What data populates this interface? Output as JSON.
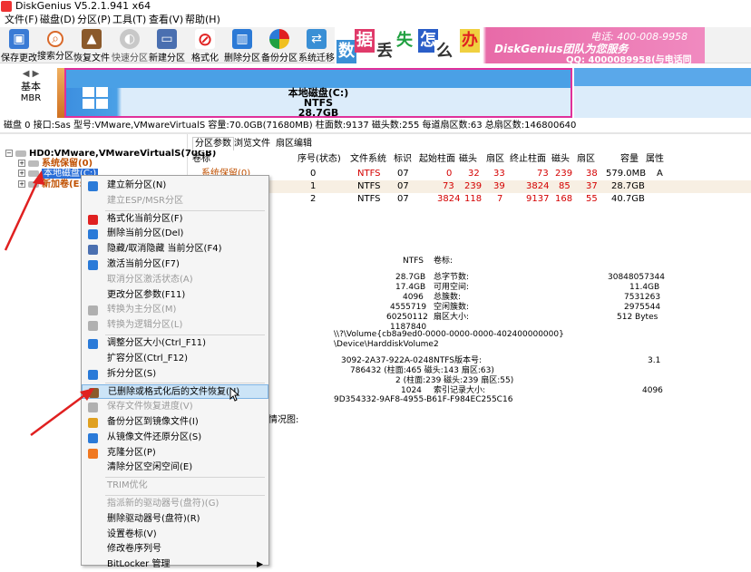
{
  "window": {
    "title": "DiskGenius V5.2.1.941 x64"
  },
  "menubar": [
    "文件(F)",
    "磁盘(D)",
    "分区(P)",
    "工具(T)",
    "查看(V)",
    "帮助(H)"
  ],
  "toolbar": [
    {
      "label": "保存更改",
      "icon": "save-icon",
      "color": "#3a7bd5"
    },
    {
      "label": "搜索分区",
      "icon": "search-icon",
      "color": "#d9692a"
    },
    {
      "label": "恢复文件",
      "icon": "recover-icon",
      "color": "#8b5a2b"
    },
    {
      "label": "快速分区",
      "icon": "quick-partition-icon",
      "color": "#9a9a9a"
    },
    {
      "label": "新建分区",
      "icon": "new-partition-icon",
      "color": "#4a6fb0"
    },
    {
      "label": "格式化",
      "icon": "format-icon",
      "color": "#e02020"
    },
    {
      "label": "删除分区",
      "icon": "delete-icon",
      "color": "#2c7ad6"
    },
    {
      "label": "备份分区",
      "icon": "backup-icon",
      "color": "#e0a020"
    },
    {
      "label": "系统迁移",
      "icon": "migrate-icon",
      "color": "#3a8fd5"
    }
  ],
  "banner": {
    "chars": [
      "数",
      "据",
      "丢",
      "失",
      "怎",
      "么",
      "办"
    ],
    "slogan": "DiskGenius团队为您服务",
    "phone": "电话: 400-008-9958",
    "qq": "QQ: 4000089958(与电话同号)"
  },
  "diskmap": {
    "disk_label": "基本",
    "disk_type": "MBR",
    "partition_name": "本地磁盘(C:)",
    "partition_fs": "NTFS",
    "partition_size": "28.7GB"
  },
  "diskinfo": "磁盘 0 接口:Sas  型号:VMware,VMwareVirtualS  容量:70.0GB(71680MB)  柱面数:9137  磁头数:255  每道扇区数:63  总扇区数:146800640",
  "tree": {
    "disk": "HD0:VMware,VMwareVirtualS(70GB)",
    "items": [
      "系统保留(0)",
      "本地磁盘(C:)",
      "新加卷(E:)"
    ]
  },
  "tabs": [
    "分区参数",
    "浏览文件",
    "扇区编辑"
  ],
  "table": {
    "headers": [
      "卷标",
      "序号(状态)",
      "文件系统",
      "标识",
      "起始柱面",
      "磁头",
      "扇区",
      "终止柱面",
      "磁头",
      "扇区",
      "容量",
      "属性"
    ],
    "rows": [
      {
        "label": "系统保留(0)",
        "num": "0",
        "fs": "NTFS",
        "id": "07",
        "sc": "0",
        "sh": "32",
        "ss": "33",
        "ec": "73",
        "eh": "239",
        "es": "38",
        "cap": "579.0MB",
        "attr": "A"
      },
      {
        "label": "",
        "num": "1",
        "fs": "NTFS",
        "id": "07",
        "sc": "73",
        "sh": "239",
        "ss": "39",
        "ec": "3824",
        "eh": "85",
        "es": "37",
        "cap": "28.7GB",
        "attr": ""
      },
      {
        "label": "",
        "num": "2",
        "fs": "NTFS",
        "id": "07",
        "sc": "3824",
        "sh": "118",
        "ss": "7",
        "ec": "9137",
        "eh": "168",
        "es": "55",
        "cap": "40.7GB",
        "attr": ""
      }
    ]
  },
  "details": {
    "fs_type": "NTFS",
    "volume_label": "卷标:",
    "left_values": [
      "28.7GB",
      "17.4GB",
      "4096",
      "4555719",
      "60250112",
      "1187840"
    ],
    "right_labels": [
      "总字节数:",
      "可用空间:",
      "总簇数:",
      "空闲簇数:",
      "扇区大小:"
    ],
    "right_values": [
      "30848057344",
      "11.4GB",
      "7531263",
      "2975544",
      "512 Bytes"
    ],
    "guid_path": "\\\\?\\Volume{cb8a9ed0-0000-0000-0000-402400000000}",
    "device_path": "\\Device\\HarddiskVolume2",
    "serial": "3092-2A37-922A-0248",
    "ntfs_version_label": "NTFS版本号:",
    "ntfs_version": "3.1",
    "mft_pos": "786432 (柱面:465 磁头:143 扇区:63)",
    "mftmirr_pos": "2 (柱面:239 磁头:239 扇区:55)",
    "index_num": "1024",
    "index_label": "索引记录大小:",
    "index_size": "4096",
    "guid2": "9D354332-9AF8-4955-B61F-F984EC255C16",
    "usage_title": "情况图:"
  },
  "context_menu": [
    {
      "label": "建立新分区(N)",
      "disabled": false,
      "icon": "new-partition-icon",
      "color": "#2a7ad8"
    },
    {
      "label": "建立ESP/MSR分区",
      "disabled": true,
      "icon": "",
      "color": ""
    },
    {
      "label": "格式化当前分区(F)",
      "disabled": false,
      "icon": "format-icon",
      "color": "#e02020"
    },
    {
      "label": "删除当前分区(Del)",
      "disabled": false,
      "icon": "delete-icon",
      "color": "#2a7ad8"
    },
    {
      "label": "隐藏/取消隐藏 当前分区(F4)",
      "disabled": false,
      "icon": "hide-icon",
      "color": "#4a6fb0"
    },
    {
      "label": "激活当前分区(F7)",
      "disabled": false,
      "icon": "activate-icon",
      "color": "#2a7ad8"
    },
    {
      "label": "取消分区激活状态(A)",
      "disabled": true,
      "icon": "",
      "color": ""
    },
    {
      "label": "更改分区参数(F11)",
      "disabled": false,
      "icon": "",
      "color": ""
    },
    {
      "label": "转换为主分区(M)",
      "disabled": true,
      "icon": "convert-icon",
      "color": "#b0b0b0"
    },
    {
      "label": "转换为逻辑分区(L)",
      "disabled": true,
      "icon": "convert-icon",
      "color": "#b0b0b0"
    },
    {
      "label": "调整分区大小(Ctrl_F11)",
      "disabled": false,
      "icon": "resize-icon",
      "color": "#2a7ad8"
    },
    {
      "label": "扩容分区(Ctrl_F12)",
      "disabled": false,
      "icon": "",
      "color": ""
    },
    {
      "label": "拆分分区(S)",
      "disabled": false,
      "icon": "split-icon",
      "color": "#2a7ad8"
    },
    {
      "label": "已删除或格式化后的文件恢复(U)",
      "disabled": false,
      "icon": "recover-icon",
      "color": "#8b5a2b"
    },
    {
      "label": "保存文件恢复进度(V)",
      "disabled": true,
      "icon": "save-progress-icon",
      "color": "#b0b0b0"
    },
    {
      "label": "备份分区到镜像文件(I)",
      "disabled": false,
      "icon": "backup-icon",
      "color": "#e0a020"
    },
    {
      "label": "从镜像文件还原分区(S)",
      "disabled": false,
      "icon": "restore-icon",
      "color": "#2a7ad8"
    },
    {
      "label": "克隆分区(P)",
      "disabled": false,
      "icon": "clone-icon",
      "color": "#f07820"
    },
    {
      "label": "清除分区空闲空间(E)",
      "disabled": false,
      "icon": "",
      "color": ""
    },
    {
      "label": "TRIM优化",
      "disabled": true,
      "icon": "",
      "color": ""
    },
    {
      "label": "指派新的驱动器号(盘符)(G)",
      "disabled": true,
      "icon": "",
      "color": ""
    },
    {
      "label": "删除驱动器号(盘符)(R)",
      "disabled": false,
      "icon": "",
      "color": ""
    },
    {
      "label": "设置卷标(V)",
      "disabled": false,
      "icon": "",
      "color": ""
    },
    {
      "label": "修改卷序列号",
      "disabled": false,
      "icon": "",
      "color": ""
    },
    {
      "label": "BitLocker 管理",
      "disabled": false,
      "icon": "",
      "color": ""
    }
  ]
}
